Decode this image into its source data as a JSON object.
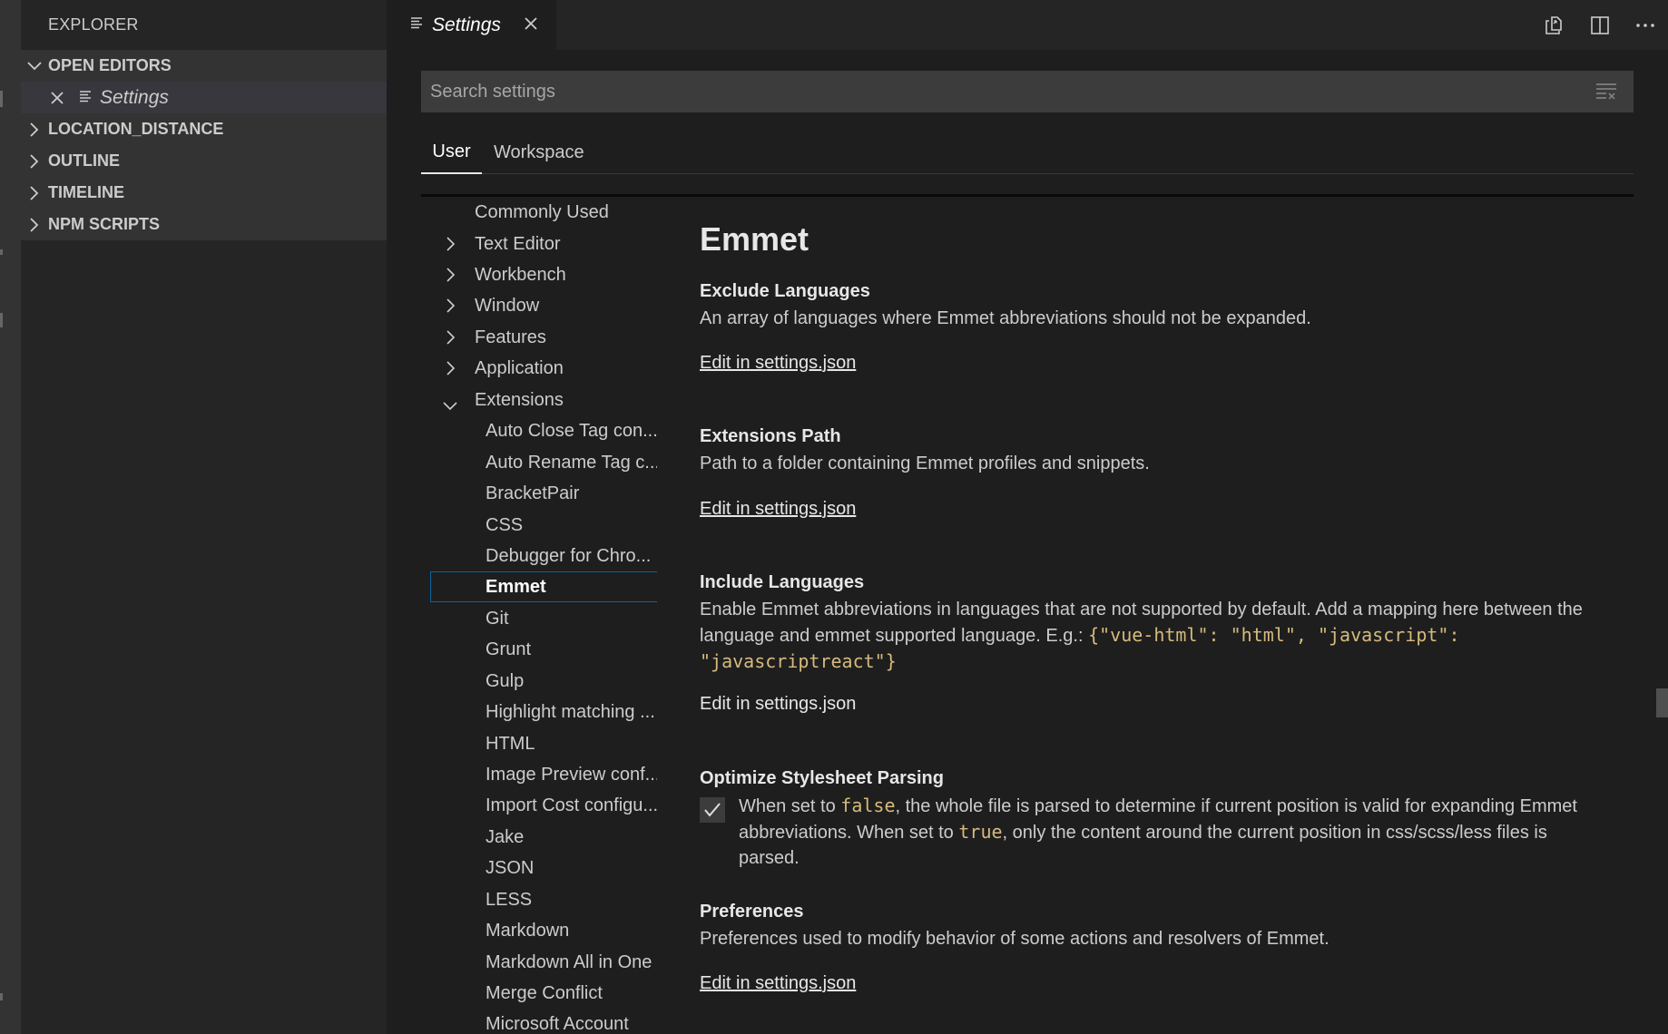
{
  "sidebar": {
    "title": "EXPLORER",
    "sections": [
      {
        "label": "OPEN EDITORS",
        "expanded": true
      },
      {
        "label": "LOCATION_DISTANCE",
        "expanded": false
      },
      {
        "label": "OUTLINE",
        "expanded": false
      },
      {
        "label": "TIMELINE",
        "expanded": false
      },
      {
        "label": "NPM SCRIPTS",
        "expanded": false
      }
    ],
    "open_editor": "Settings"
  },
  "editor_tab": {
    "label": "Settings"
  },
  "search": {
    "placeholder": "Search settings",
    "value": ""
  },
  "scope_tabs": [
    {
      "label": "User",
      "active": true
    },
    {
      "label": "Workspace",
      "active": false
    }
  ],
  "toc": {
    "top_items": [
      "Commonly Used",
      "Text Editor",
      "Workbench",
      "Window",
      "Features",
      "Application",
      "Extensions"
    ],
    "extensions": [
      "Auto Close Tag con...",
      "Auto Rename Tag c...",
      "BracketPair",
      "CSS",
      "Debugger for Chro...",
      "Emmet",
      "Git",
      "Grunt",
      "Gulp",
      "Highlight matching ...",
      "HTML",
      "Image Preview conf...",
      "Import Cost configu...",
      "Jake",
      "JSON",
      "LESS",
      "Markdown",
      "Markdown All in One",
      "Merge Conflict",
      "Microsoft Account"
    ],
    "selected": "Emmet"
  },
  "content": {
    "heading": "Emmet",
    "edit_link": "Edit in settings.json",
    "settings": {
      "exclude": {
        "title": "Exclude Languages",
        "desc": "An array of languages where Emmet abbreviations should not be expanded."
      },
      "extensions_path": {
        "title": "Extensions Path",
        "desc": "Path to a folder containing Emmet profiles and snippets."
      },
      "include": {
        "title": "Include Languages",
        "desc_line1": "Enable Emmet abbreviations in languages that are not supported by default. Add a mapping here between the",
        "desc_line2": "language and emmet supported language. E.g.: ",
        "code1": "{\"vue-html\": \"html\", \"javascript\":",
        "code2": "\"javascriptreact\"}"
      },
      "optimize": {
        "title": "Optimize Stylesheet Parsing",
        "checked": true,
        "t1": "When set to ",
        "c1": "false",
        "t2": ", the whole file is parsed to determine if current position is valid for expanding Emmet",
        "t3": "abbreviations. When set to ",
        "c2": "true",
        "t4": ", only the content around the current position in css/scss/less files is parsed."
      },
      "preferences": {
        "title": "Preferences",
        "desc": "Preferences used to modify behavior of some actions and resolvers of Emmet."
      }
    }
  },
  "colors": {
    "code": "#d7ba7d",
    "selected_border": "#0e639c"
  },
  "icons": [
    "chevron-down-icon",
    "chevron-right-icon",
    "close-icon",
    "lines-icon",
    "open-file-icon",
    "split-editor-icon",
    "more-icon",
    "clear-filter-icon",
    "check-icon"
  ]
}
